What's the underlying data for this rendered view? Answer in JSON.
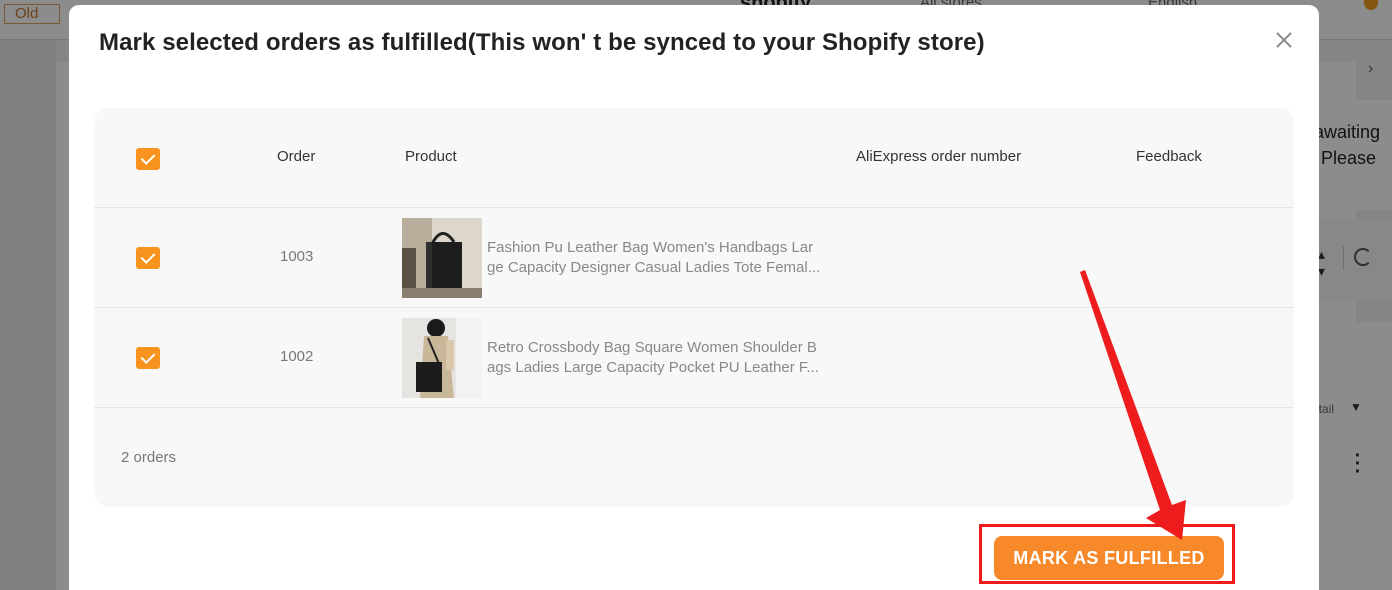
{
  "background": {
    "old_label": "Old",
    "logo_text": "shopify",
    "stores_label": "All stores",
    "language_label": "English",
    "side_text_line1": "awaiting",
    "side_text_line2": "Please",
    "detail_label": "etail"
  },
  "modal": {
    "title": "Mark selected orders as fulfilled(This won' t be synced to your Shopify store)",
    "close_icon": "close-icon",
    "table": {
      "headers": {
        "order": "Order",
        "product": "Product",
        "aliexpress_order_number": "AliExpress order number",
        "feedback": "Feedback"
      },
      "rows": [
        {
          "checked": true,
          "order": "1003",
          "product_line1": "Fashion Pu Leather Bag Women's Handbags Lar",
          "product_line2": "ge Capacity Designer Casual Ladies Tote Femal...",
          "aliexpress_order_number": "",
          "feedback": ""
        },
        {
          "checked": true,
          "order": "1002",
          "product_line1": "Retro Crossbody Bag Square Women Shoulder B",
          "product_line2": "ags Ladies Large Capacity Pocket PU Leather F...",
          "aliexpress_order_number": "",
          "feedback": ""
        }
      ],
      "footer_count": "2 orders"
    },
    "primary_button": "MARK AS FULFILLED"
  },
  "colors": {
    "accent": "#f7892b",
    "checkbox": "#f7931e",
    "annotation_red": "#ee1c1c"
  }
}
